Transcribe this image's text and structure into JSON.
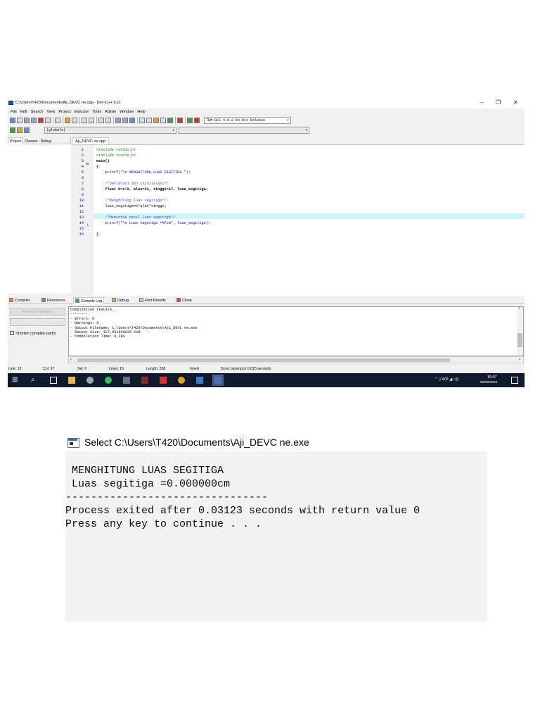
{
  "ide": {
    "title": "C:\\Users\\T420\\Documents\\Aji_DEVC ne.cpp - Dev-C++ 5.11",
    "window_controls": {
      "minimize": "–",
      "maximize": "❐",
      "close": "✕"
    },
    "menu": [
      "File",
      "Edit",
      "Search",
      "View",
      "Project",
      "Execute",
      "Tools",
      "AStyle",
      "Window",
      "Help"
    ],
    "compiler_select": "TDM-GCC 4.9.2 64-bit Release",
    "globals_select": "(globals)",
    "left_tabs": [
      "Project",
      "Classes",
      "Debug"
    ],
    "editor_tab": "Aji_DEVC ne.cpp",
    "code_lines": [
      {
        "n": "1",
        "text": "#include <stdio.h>",
        "cls": "inc"
      },
      {
        "n": "2",
        "text": "#include <conio.h>",
        "cls": "inc"
      },
      {
        "n": "3",
        "text": "main()",
        "cls": "kw"
      },
      {
        "n": "4",
        "text": "{",
        "cls": "br"
      },
      {
        "n": "5",
        "text": "    printf(\"\\n MENGHITUNG LUAS SEGITIGA \");",
        "cls": "str"
      },
      {
        "n": "6",
        "text": "",
        "cls": ""
      },
      {
        "n": "7",
        "text": "    /*Deklarasi dan inisilisasi*/",
        "cls": "cmt"
      },
      {
        "n": "8",
        "text": "    float k=1/2, alas=21, tinggi=17, luas_segitiga;",
        "cls": "kw"
      },
      {
        "n": "9",
        "text": "",
        "cls": ""
      },
      {
        "n": "10",
        "text": "    /*Menghitung luas segitiga*/",
        "cls": "cmt"
      },
      {
        "n": "11",
        "text": "    luas_segitiga=k*alas*tinggi;",
        "cls": ""
      },
      {
        "n": "12",
        "text": "",
        "cls": ""
      },
      {
        "n": "13",
        "text": "    /*Mencetak hasil luas segitiga*/",
        "cls": "cmt"
      },
      {
        "n": "14",
        "text": "    printf(\"\\n Luas segitiga =%fcm\", luas_segitiga);",
        "cls": "str"
      },
      {
        "n": "15",
        "text": "",
        "cls": ""
      },
      {
        "n": "16",
        "text": "}",
        "cls": "br"
      }
    ],
    "bottom_tabs": [
      "Compiler",
      "Resources",
      "Compile Log",
      "Debug",
      "Find Results",
      "Close"
    ],
    "abort_button": "Abort Compilation",
    "shorten_paths": "Shorten compiler paths",
    "compile_log": [
      "Compilation results...",
      "--------",
      "- Errors: 0",
      "- Warnings: 0",
      "- Output Filename: C:\\Users\\T420\\Documents\\Aji_DEVC ne.exe",
      "- Output Size: 127,931640625 KiB",
      "- Compilation Time: 0,28s"
    ],
    "status": {
      "line": "Line:   13",
      "col": "Col:   37",
      "sel": "Sel:   0",
      "lines": "Lines:   16",
      "length": "Length:   338",
      "mode": "Insert",
      "message": "Done parsing in 0,015 seconds"
    },
    "taskbar": {
      "tray": "⌃ ▯ WD ◢ ◁))",
      "time": "15:07",
      "date": "06/09/2023"
    }
  },
  "console": {
    "title": "Select C:\\Users\\T420\\Documents\\Aji_DEVC ne.exe",
    "lines": [
      " MENGHITUNG LUAS SEGITIGA",
      " Luas segitiga =0.000000cm",
      "--------------------------------",
      "Process exited after 0.03123 seconds with return value 0",
      "Press any key to continue . . ."
    ]
  }
}
